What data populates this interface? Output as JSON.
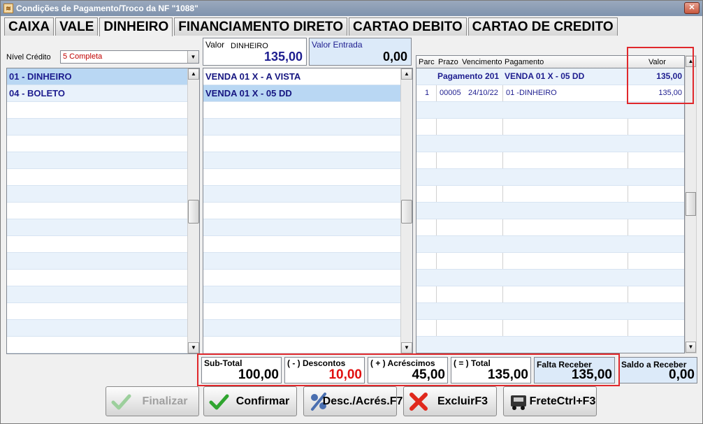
{
  "window": {
    "title": "Condições de Pagamento/Troco da NF \"1088\""
  },
  "tabs": [
    "CAIXA",
    "VALE",
    "DINHEIRO",
    "FINANCIAMENTO DIRETO",
    "CARTAO DEBITO",
    "CARTAO DE CREDITO"
  ],
  "active_tab": "DINHEIRO",
  "nivel_credito": {
    "label": "Nível Crédito",
    "value": "5 Completa"
  },
  "formas": [
    "01 - DINHEIRO",
    "04 - BOLETO"
  ],
  "condicoes": [
    "VENDA 01 X - A VISTA",
    "VENDA 01 X - 05 DD"
  ],
  "valor": {
    "label": "Valor",
    "sub": "DINHEIRO",
    "amount": "135,00"
  },
  "valor_entrada": {
    "label": "Valor Entrada",
    "amount": "0,00"
  },
  "parcelas": {
    "headers": {
      "parc": "Parc",
      "prazo": "Prazo",
      "vencimento": "Vencimento",
      "pagamento": "Pagamento",
      "valor": "Valor"
    },
    "group": {
      "label": "Pagamento  201",
      "pagamento": "VENDA 01 X - 05 DD",
      "valor": "135,00"
    },
    "rows": [
      {
        "parc": "1",
        "prazo": "00005",
        "vencimento": "24/10/22",
        "pagamento": "01 -DINHEIRO",
        "valor": "135,00"
      }
    ]
  },
  "totais": {
    "subtotal": {
      "label": "Sub-Total",
      "value": "100,00"
    },
    "descontos": {
      "label": "( - ) Descontos",
      "value": "10,00"
    },
    "acrescimos": {
      "label": "( + ) Acréscimos",
      "value": "45,00"
    },
    "total": {
      "label": "( = ) Total",
      "value": "135,00"
    },
    "falta_receber": {
      "label": "Falta Receber",
      "value": "135,00"
    },
    "saldo_receber": {
      "label": "Saldo a Receber",
      "value": "0,00"
    }
  },
  "buttons": {
    "finalizar": "Finalizar",
    "confirmar": "Confirmar",
    "desc_acres": "Desc./Acrés.",
    "desc_acres_key": "F7",
    "excluir": "Excluir",
    "excluir_key": "F3",
    "frete": "Frete",
    "frete_key": "Ctrl+F3"
  },
  "colors": {
    "highlight": "#e0282c",
    "descontos": "#e01010",
    "value_blue": "#1d1d8f"
  }
}
